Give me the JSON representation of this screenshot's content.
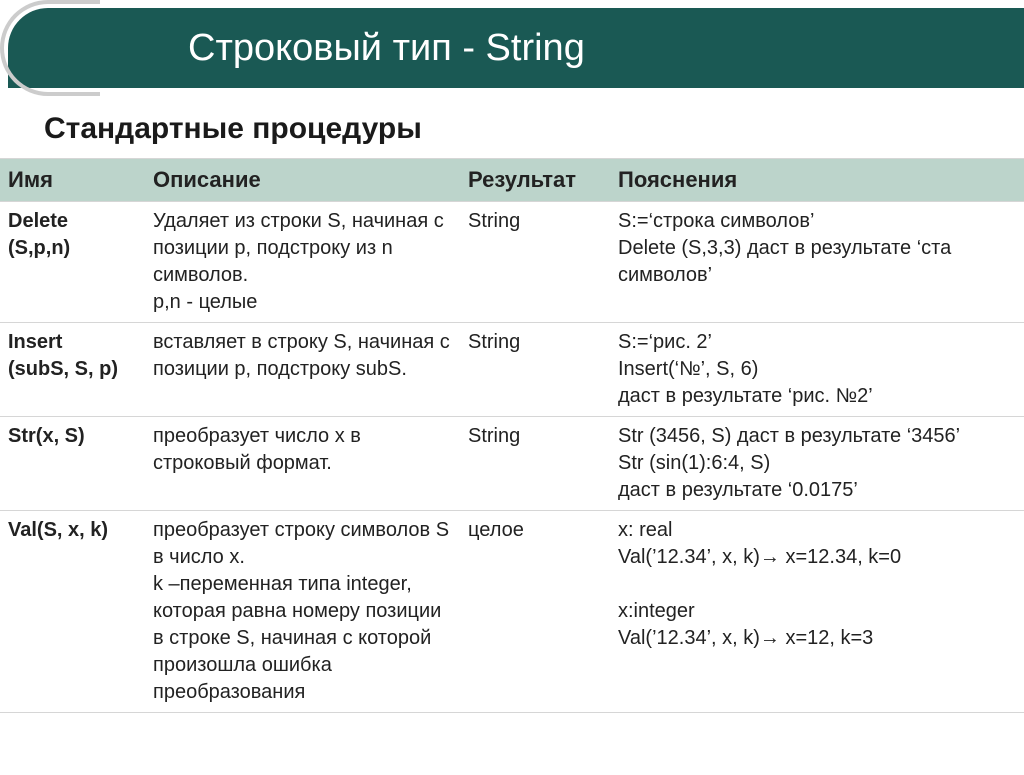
{
  "title": "Строковый тип - String",
  "subtitle": "Стандартные процедуры",
  "headers": {
    "name": "Имя",
    "desc": "Описание",
    "result": "Результат",
    "explain": "Пояснения"
  },
  "rows": [
    {
      "name_lines": [
        "Delete",
        "(S,p,n)"
      ],
      "desc_lines": [
        "Удаляет из строки S, начиная с позиции p, подстроку из n символов.",
        "p,n - целые"
      ],
      "result": "String",
      "explain_lines": [
        "S:=‘строка символов’",
        "Delete (S,3,3) даст в результате ‘ста символов’"
      ]
    },
    {
      "name_lines": [
        "Insert",
        "(subS, S, p)"
      ],
      "desc_lines": [
        "вставляет в строку S, начиная с позиции p, подстроку subS."
      ],
      "result": "String",
      "explain_lines": [
        "S:=‘рис. 2’",
        "Insert(‘№’, S, 6)",
        "даст в результате ‘рис. №2’"
      ]
    },
    {
      "name_lines": [
        "Str(x, S)"
      ],
      "desc_lines": [
        "преобразует число x в строковый формат."
      ],
      "result": "String",
      "explain_lines": [
        "Str (3456, S) даст в результате ‘3456’",
        "Str (sin(1):6:4, S)",
        "даст в результате  ‘0.0175’"
      ]
    },
    {
      "name_lines": [
        "Val(S, x, k)"
      ],
      "desc_lines": [
        "преобразует строку символов S в число x.",
        "k –переменная типа integer, которая равна номеру позиции в строке S, начиная с которой произошла ошибка преобразования"
      ],
      "result": "целое",
      "explain_lines": [
        "x: real",
        "Val(’12.34’, x, k)→ x=12.34, k=0",
        " ",
        "x:integer",
        "Val(’12.34’, x, k)→ x=12, k=3"
      ]
    }
  ]
}
